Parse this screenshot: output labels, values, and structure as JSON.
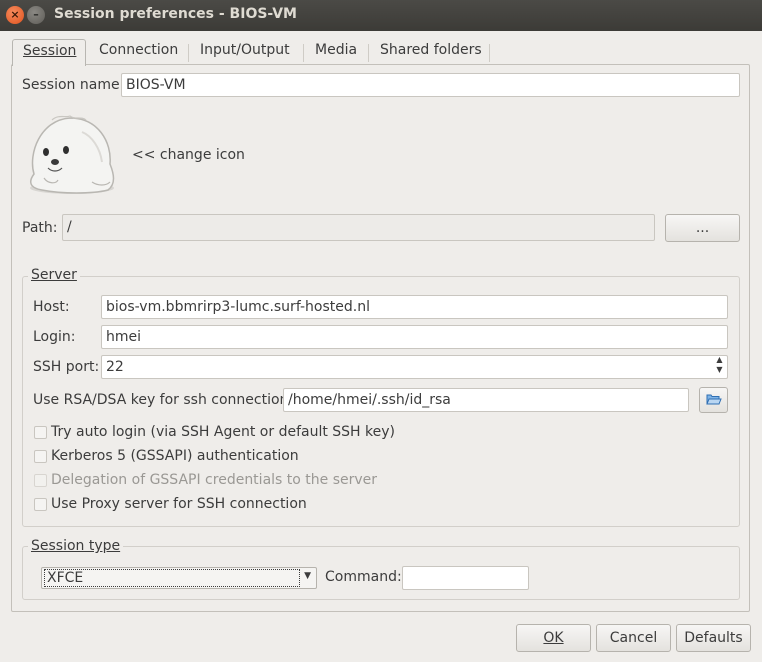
{
  "window": {
    "title": "Session preferences - BIOS-VM",
    "close_glyph": "×",
    "minimize_glyph": "–"
  },
  "tabs": [
    "Session",
    "Connection",
    "Input/Output",
    "Media",
    "Shared folders"
  ],
  "session": {
    "name_label": "Session name:",
    "name_value": "BIOS-VM",
    "change_icon": "<< change icon",
    "path_label": "Path:",
    "path_value": "/",
    "path_button": "..."
  },
  "server": {
    "title": "Server",
    "host_label": "Host:",
    "host_value": "bios-vm.bbmrirp3-lumc.surf-hosted.nl",
    "login_label": "Login:",
    "login_value": "hmei",
    "port_label": "SSH port:",
    "port_value": "22",
    "key_label": "Use RSA/DSA key for ssh connection:",
    "key_value": "/home/hmei/.ssh/id_rsa",
    "checkboxes": [
      {
        "label": "Try auto login (via SSH Agent or default SSH key)",
        "checked": false,
        "enabled": true
      },
      {
        "label": "Kerberos 5 (GSSAPI) authentication",
        "checked": false,
        "enabled": true
      },
      {
        "label": "Delegation of GSSAPI credentials to the server",
        "checked": false,
        "enabled": false
      },
      {
        "label": "Use Proxy server for SSH connection",
        "checked": false,
        "enabled": true
      }
    ]
  },
  "session_type": {
    "title": "Session type",
    "selected": "XFCE",
    "command_label": "Command:",
    "command_value": ""
  },
  "buttons": {
    "ok": "OK",
    "cancel": "Cancel",
    "defaults": "Defaults"
  },
  "colors": {
    "titlebar": "#3c3b37",
    "close_button": "#e0531e",
    "window_bg": "#efedea"
  },
  "icons": {
    "session_icon": "seal-icon",
    "file_browse": "folder-open-icon"
  }
}
